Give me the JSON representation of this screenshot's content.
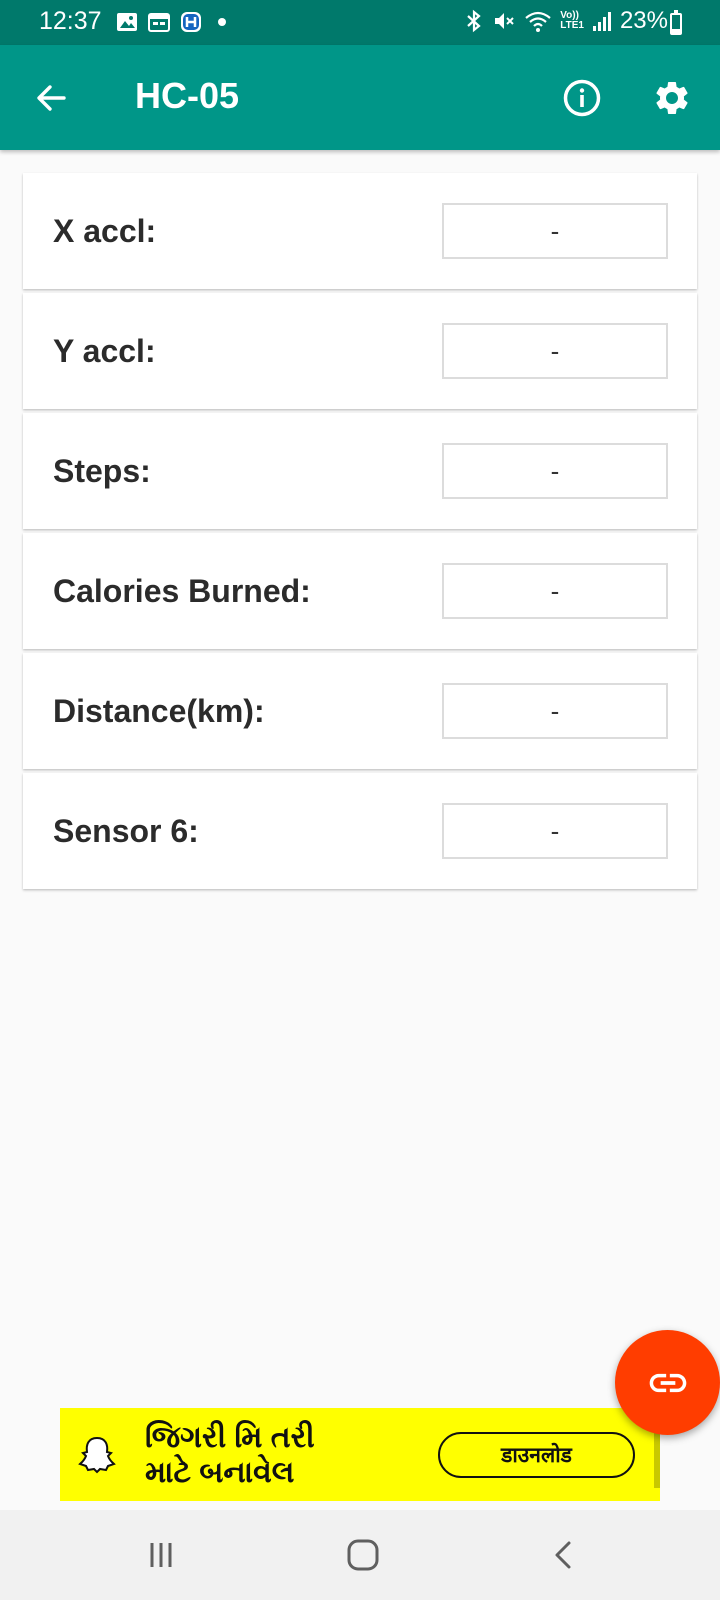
{
  "status_bar": {
    "time": "12:37",
    "battery_text": "23%",
    "battery_level": 0.23,
    "left_icons": [
      "gallery-icon",
      "calendar-icon",
      "h-app-icon",
      "notification-dot"
    ],
    "right_icons": [
      "bluetooth-icon",
      "mute-icon",
      "wifi-icon",
      "volte-lte-icon",
      "signal-icon",
      "battery-icon"
    ],
    "volte_label": "Vo))",
    "lte_label": "LTE1"
  },
  "app_bar": {
    "title": "HC-05",
    "back_icon": "arrow-back-icon",
    "info_icon": "info-icon",
    "settings_icon": "gear-icon",
    "color": "#009688"
  },
  "sensors": [
    {
      "label": "X accl:",
      "value": "-"
    },
    {
      "label": "Y accl:",
      "value": "-"
    },
    {
      "label": "Steps:",
      "value": "-"
    },
    {
      "label": "Calories Burned:",
      "value": "-"
    },
    {
      "label": "Distance(km):",
      "value": "-"
    },
    {
      "label": "Sensor 6:",
      "value": "-"
    }
  ],
  "fab": {
    "icon": "link-icon",
    "color": "#ff3d00"
  },
  "ad": {
    "logo_icon": "snapchat-ghost-icon",
    "text_line1": "જિગરી મિ તરી",
    "text_line2": "માટે બનાવેલ",
    "cta": "डाउनलोड",
    "background": "#ffff00"
  },
  "nav_bar": {
    "recents_icon": "recents-icon",
    "home_icon": "home-icon",
    "back_icon": "nav-back-icon"
  }
}
